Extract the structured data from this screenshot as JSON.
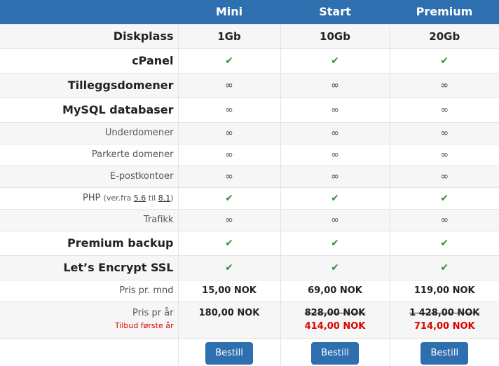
{
  "plans": [
    "Mini",
    "Start",
    "Premium"
  ],
  "rows": {
    "diskplass": {
      "label": "Diskplass",
      "values": [
        "1Gb",
        "10Gb",
        "20Gb"
      ]
    },
    "cpanel": {
      "label": "cPanel"
    },
    "tilleggsdomener": {
      "label": "Tilleggsdomener"
    },
    "mysql": {
      "label": "MySQL databaser"
    },
    "underdomener": {
      "label": "Underdomener"
    },
    "parkerte": {
      "label": "Parkerte domener"
    },
    "epost": {
      "label": "E-postkontoer"
    },
    "php": {
      "label": "PHP",
      "note_prefix": "(ver.fra",
      "ver_from": "5.6",
      "note_mid": "til",
      "ver_to": "8.1",
      "note_suffix": ")"
    },
    "trafikk": {
      "label": "Trafikk"
    },
    "backup": {
      "label": "Premium backup"
    },
    "ssl": {
      "label": "Let’s Encrypt SSL"
    }
  },
  "symbols": {
    "check": "✔",
    "infinity": "∞"
  },
  "pricing": {
    "monthly": {
      "label": "Pris pr. mnd",
      "values": [
        "15,00 NOK",
        "69,00 NOK",
        "119,00 NOK"
      ]
    },
    "yearly": {
      "label": "Pris pr år",
      "offer_note": "Tilbud første år",
      "mini": "180,00 NOK",
      "start_old": "828,00 NOK",
      "start_offer": "414,00 NOK",
      "premium_old": "1 428,00 NOK",
      "premium_offer": "714,00 NOK"
    }
  },
  "order_button": "Bestill",
  "colors": {
    "header": "#2e6fb0",
    "check": "#3a8c3a",
    "offer": "#e00000",
    "button": "#2e6fb0"
  }
}
